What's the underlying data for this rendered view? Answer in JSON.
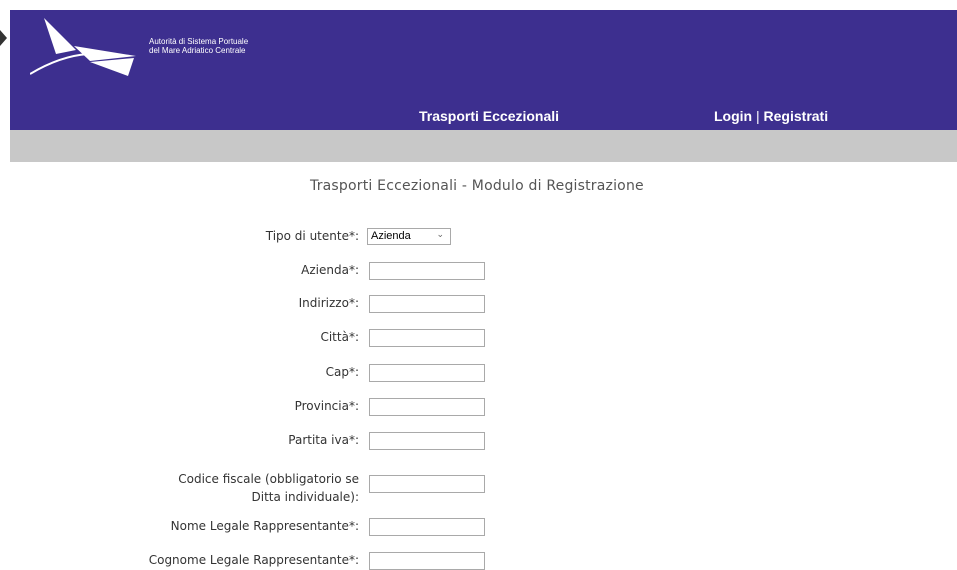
{
  "header": {
    "org_line1": "Autorità di Sistema Portuale",
    "org_line2": "del Mare Adriatico Centrale",
    "nav_main": "Trasporti Eccezionali",
    "login": "Login",
    "separator": "|",
    "register": "Registrati",
    "bg_color": "#3d2f8f"
  },
  "page": {
    "title": "Trasporti Eccezionali - Modulo di Registrazione"
  },
  "form": {
    "user_type": {
      "label": "Tipo di utente*:",
      "value": "Azienda"
    },
    "fields": [
      {
        "label": "Azienda*:",
        "value": ""
      },
      {
        "label": "Indirizzo*:",
        "value": ""
      },
      {
        "label": "Città*:",
        "value": ""
      },
      {
        "label": "Cap*:",
        "value": ""
      },
      {
        "label": "Provincia*:",
        "value": ""
      },
      {
        "label": "Partita iva*:",
        "value": ""
      },
      {
        "label_line1": "Codice fiscale (obbligatorio se",
        "label_line2": "Ditta individuale):",
        "value": ""
      },
      {
        "label": "Nome Legale Rappresentante*:",
        "value": ""
      },
      {
        "label": "Cognome Legale Rappresentante*:",
        "value": ""
      }
    ]
  }
}
